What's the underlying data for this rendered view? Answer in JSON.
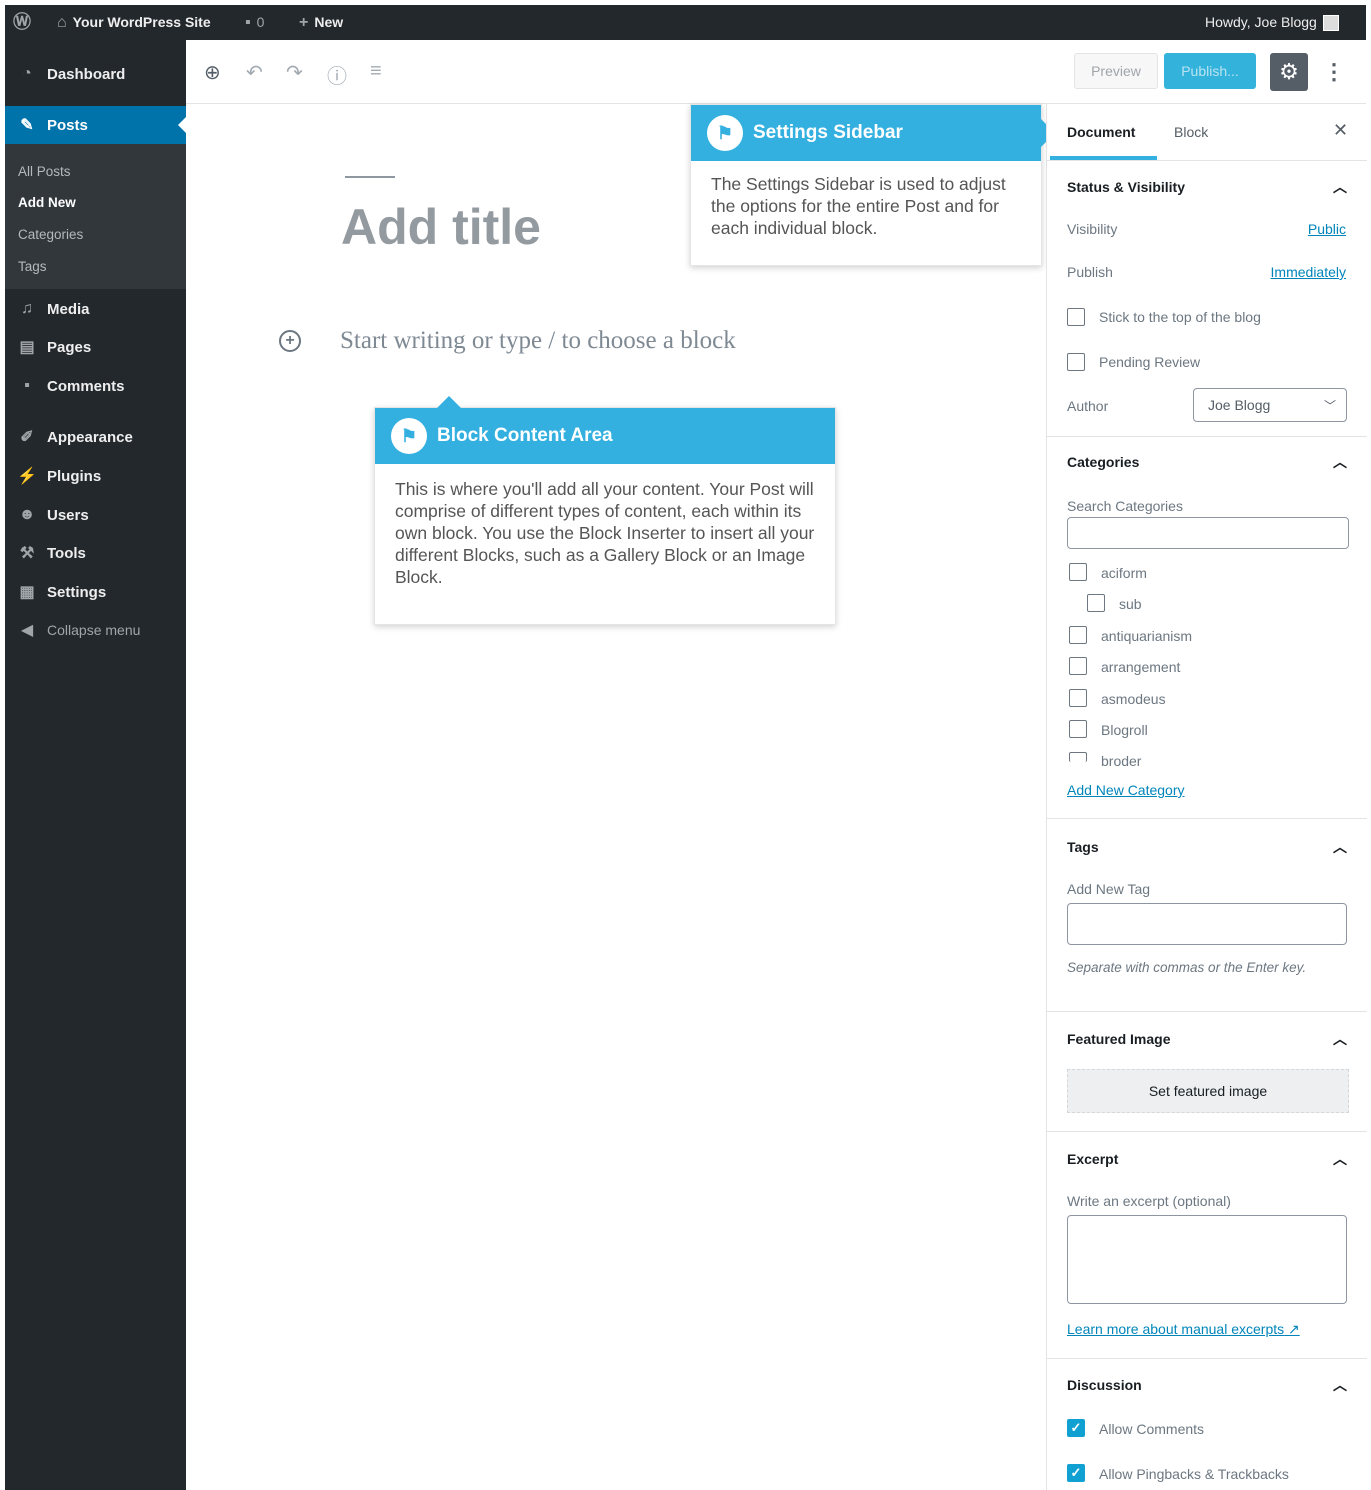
{
  "adminbar": {
    "site_name": "Your WordPress Site",
    "comments_count": "0",
    "new_label": "New",
    "greeting": "Howdy, Joe Blogg"
  },
  "sidebar": {
    "items": [
      {
        "label": "Dashboard",
        "icon": "dashboard-icon"
      },
      {
        "label": "Posts",
        "icon": "pin-icon"
      },
      {
        "label": "Media",
        "icon": "media-icon"
      },
      {
        "label": "Pages",
        "icon": "pages-icon"
      },
      {
        "label": "Comments",
        "icon": "comments-icon"
      },
      {
        "label": "Appearance",
        "icon": "brush-icon"
      },
      {
        "label": "Plugins",
        "icon": "plug-icon"
      },
      {
        "label": "Users",
        "icon": "users-icon"
      },
      {
        "label": "Tools",
        "icon": "wrench-icon"
      },
      {
        "label": "Settings",
        "icon": "settings-icon"
      },
      {
        "label": "Collapse menu",
        "icon": "collapse-icon"
      }
    ],
    "submenu": [
      "All Posts",
      "Add New",
      "Categories",
      "Tags"
    ]
  },
  "toolbar": {
    "preview_label": "Preview",
    "publish_label": "Publish..."
  },
  "editor": {
    "title_placeholder": "Add title",
    "body_placeholder": "Start writing or type / to choose a block"
  },
  "callouts": {
    "settings": {
      "title": "Settings Sidebar",
      "body": "The Settings Sidebar is used to adjust the options for the entire Post and for each individual block."
    },
    "block": {
      "title": "Block Content Area",
      "body": "This is where you'll add all your content. Your Post will comprise of different types of content, each within its own block. You use the Block Inserter to insert all your different Blocks, such as a Gallery Block or an Image Block."
    }
  },
  "settings_sidebar": {
    "tabs": [
      "Document",
      "Block"
    ],
    "status": {
      "title": "Status & Visibility",
      "visibility_label": "Visibility",
      "visibility_value": "Public",
      "publish_label": "Publish",
      "publish_value": "Immediately",
      "sticky_label": "Stick to the top of the blog",
      "pending_label": "Pending Review",
      "author_label": "Author",
      "author_value": "Joe Blogg"
    },
    "categories": {
      "title": "Categories",
      "search_label": "Search Categories",
      "items": [
        "aciform",
        "sub",
        "antiquarianism",
        "arrangement",
        "asmodeus",
        "Blogroll",
        "broder"
      ],
      "add_link": "Add New Category"
    },
    "tags": {
      "title": "Tags",
      "add_label": "Add New Tag",
      "help": "Separate with commas or the Enter key."
    },
    "featured": {
      "title": "Featured Image",
      "button": "Set featured image"
    },
    "excerpt": {
      "title": "Excerpt",
      "label": "Write an excerpt (optional)",
      "link": "Learn more about manual excerpts"
    },
    "discussion": {
      "title": "Discussion",
      "allow_comments": "Allow Comments",
      "allow_pingbacks": "Allow Pingbacks & Trackbacks"
    }
  },
  "colors": {
    "admin_dark": "#23282d",
    "accent_blue": "#0073aa",
    "callout_blue": "#33b0df"
  }
}
